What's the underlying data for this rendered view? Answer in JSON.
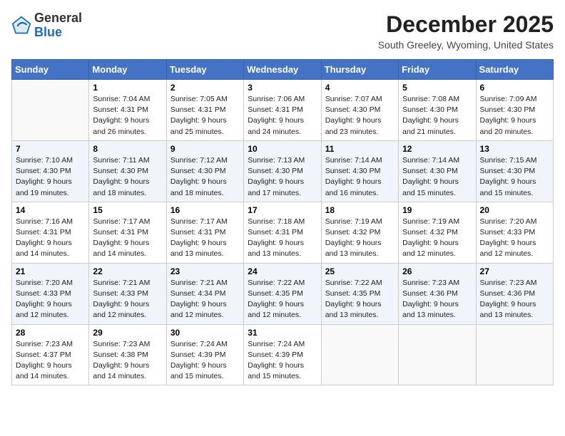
{
  "logo": {
    "general": "General",
    "blue": "Blue"
  },
  "title": "December 2025",
  "subtitle": "South Greeley, Wyoming, United States",
  "days_of_week": [
    "Sunday",
    "Monday",
    "Tuesday",
    "Wednesday",
    "Thursday",
    "Friday",
    "Saturday"
  ],
  "weeks": [
    [
      {
        "day": "",
        "sunrise": "",
        "sunset": "",
        "daylight": ""
      },
      {
        "day": "1",
        "sunrise": "Sunrise: 7:04 AM",
        "sunset": "Sunset: 4:31 PM",
        "daylight": "Daylight: 9 hours and 26 minutes."
      },
      {
        "day": "2",
        "sunrise": "Sunrise: 7:05 AM",
        "sunset": "Sunset: 4:31 PM",
        "daylight": "Daylight: 9 hours and 25 minutes."
      },
      {
        "day": "3",
        "sunrise": "Sunrise: 7:06 AM",
        "sunset": "Sunset: 4:31 PM",
        "daylight": "Daylight: 9 hours and 24 minutes."
      },
      {
        "day": "4",
        "sunrise": "Sunrise: 7:07 AM",
        "sunset": "Sunset: 4:30 PM",
        "daylight": "Daylight: 9 hours and 23 minutes."
      },
      {
        "day": "5",
        "sunrise": "Sunrise: 7:08 AM",
        "sunset": "Sunset: 4:30 PM",
        "daylight": "Daylight: 9 hours and 21 minutes."
      },
      {
        "day": "6",
        "sunrise": "Sunrise: 7:09 AM",
        "sunset": "Sunset: 4:30 PM",
        "daylight": "Daylight: 9 hours and 20 minutes."
      }
    ],
    [
      {
        "day": "7",
        "sunrise": "Sunrise: 7:10 AM",
        "sunset": "Sunset: 4:30 PM",
        "daylight": "Daylight: 9 hours and 19 minutes."
      },
      {
        "day": "8",
        "sunrise": "Sunrise: 7:11 AM",
        "sunset": "Sunset: 4:30 PM",
        "daylight": "Daylight: 9 hours and 18 minutes."
      },
      {
        "day": "9",
        "sunrise": "Sunrise: 7:12 AM",
        "sunset": "Sunset: 4:30 PM",
        "daylight": "Daylight: 9 hours and 18 minutes."
      },
      {
        "day": "10",
        "sunrise": "Sunrise: 7:13 AM",
        "sunset": "Sunset: 4:30 PM",
        "daylight": "Daylight: 9 hours and 17 minutes."
      },
      {
        "day": "11",
        "sunrise": "Sunrise: 7:14 AM",
        "sunset": "Sunset: 4:30 PM",
        "daylight": "Daylight: 9 hours and 16 minutes."
      },
      {
        "day": "12",
        "sunrise": "Sunrise: 7:14 AM",
        "sunset": "Sunset: 4:30 PM",
        "daylight": "Daylight: 9 hours and 15 minutes."
      },
      {
        "day": "13",
        "sunrise": "Sunrise: 7:15 AM",
        "sunset": "Sunset: 4:30 PM",
        "daylight": "Daylight: 9 hours and 15 minutes."
      }
    ],
    [
      {
        "day": "14",
        "sunrise": "Sunrise: 7:16 AM",
        "sunset": "Sunset: 4:31 PM",
        "daylight": "Daylight: 9 hours and 14 minutes."
      },
      {
        "day": "15",
        "sunrise": "Sunrise: 7:17 AM",
        "sunset": "Sunset: 4:31 PM",
        "daylight": "Daylight: 9 hours and 14 minutes."
      },
      {
        "day": "16",
        "sunrise": "Sunrise: 7:17 AM",
        "sunset": "Sunset: 4:31 PM",
        "daylight": "Daylight: 9 hours and 13 minutes."
      },
      {
        "day": "17",
        "sunrise": "Sunrise: 7:18 AM",
        "sunset": "Sunset: 4:31 PM",
        "daylight": "Daylight: 9 hours and 13 minutes."
      },
      {
        "day": "18",
        "sunrise": "Sunrise: 7:19 AM",
        "sunset": "Sunset: 4:32 PM",
        "daylight": "Daylight: 9 hours and 13 minutes."
      },
      {
        "day": "19",
        "sunrise": "Sunrise: 7:19 AM",
        "sunset": "Sunset: 4:32 PM",
        "daylight": "Daylight: 9 hours and 12 minutes."
      },
      {
        "day": "20",
        "sunrise": "Sunrise: 7:20 AM",
        "sunset": "Sunset: 4:33 PM",
        "daylight": "Daylight: 9 hours and 12 minutes."
      }
    ],
    [
      {
        "day": "21",
        "sunrise": "Sunrise: 7:20 AM",
        "sunset": "Sunset: 4:33 PM",
        "daylight": "Daylight: 9 hours and 12 minutes."
      },
      {
        "day": "22",
        "sunrise": "Sunrise: 7:21 AM",
        "sunset": "Sunset: 4:33 PM",
        "daylight": "Daylight: 9 hours and 12 minutes."
      },
      {
        "day": "23",
        "sunrise": "Sunrise: 7:21 AM",
        "sunset": "Sunset: 4:34 PM",
        "daylight": "Daylight: 9 hours and 12 minutes."
      },
      {
        "day": "24",
        "sunrise": "Sunrise: 7:22 AM",
        "sunset": "Sunset: 4:35 PM",
        "daylight": "Daylight: 9 hours and 12 minutes."
      },
      {
        "day": "25",
        "sunrise": "Sunrise: 7:22 AM",
        "sunset": "Sunset: 4:35 PM",
        "daylight": "Daylight: 9 hours and 13 minutes."
      },
      {
        "day": "26",
        "sunrise": "Sunrise: 7:23 AM",
        "sunset": "Sunset: 4:36 PM",
        "daylight": "Daylight: 9 hours and 13 minutes."
      },
      {
        "day": "27",
        "sunrise": "Sunrise: 7:23 AM",
        "sunset": "Sunset: 4:36 PM",
        "daylight": "Daylight: 9 hours and 13 minutes."
      }
    ],
    [
      {
        "day": "28",
        "sunrise": "Sunrise: 7:23 AM",
        "sunset": "Sunset: 4:37 PM",
        "daylight": "Daylight: 9 hours and 14 minutes."
      },
      {
        "day": "29",
        "sunrise": "Sunrise: 7:23 AM",
        "sunset": "Sunset: 4:38 PM",
        "daylight": "Daylight: 9 hours and 14 minutes."
      },
      {
        "day": "30",
        "sunrise": "Sunrise: 7:24 AM",
        "sunset": "Sunset: 4:39 PM",
        "daylight": "Daylight: 9 hours and 15 minutes."
      },
      {
        "day": "31",
        "sunrise": "Sunrise: 7:24 AM",
        "sunset": "Sunset: 4:39 PM",
        "daylight": "Daylight: 9 hours and 15 minutes."
      },
      {
        "day": "",
        "sunrise": "",
        "sunset": "",
        "daylight": ""
      },
      {
        "day": "",
        "sunrise": "",
        "sunset": "",
        "daylight": ""
      },
      {
        "day": "",
        "sunrise": "",
        "sunset": "",
        "daylight": ""
      }
    ]
  ]
}
